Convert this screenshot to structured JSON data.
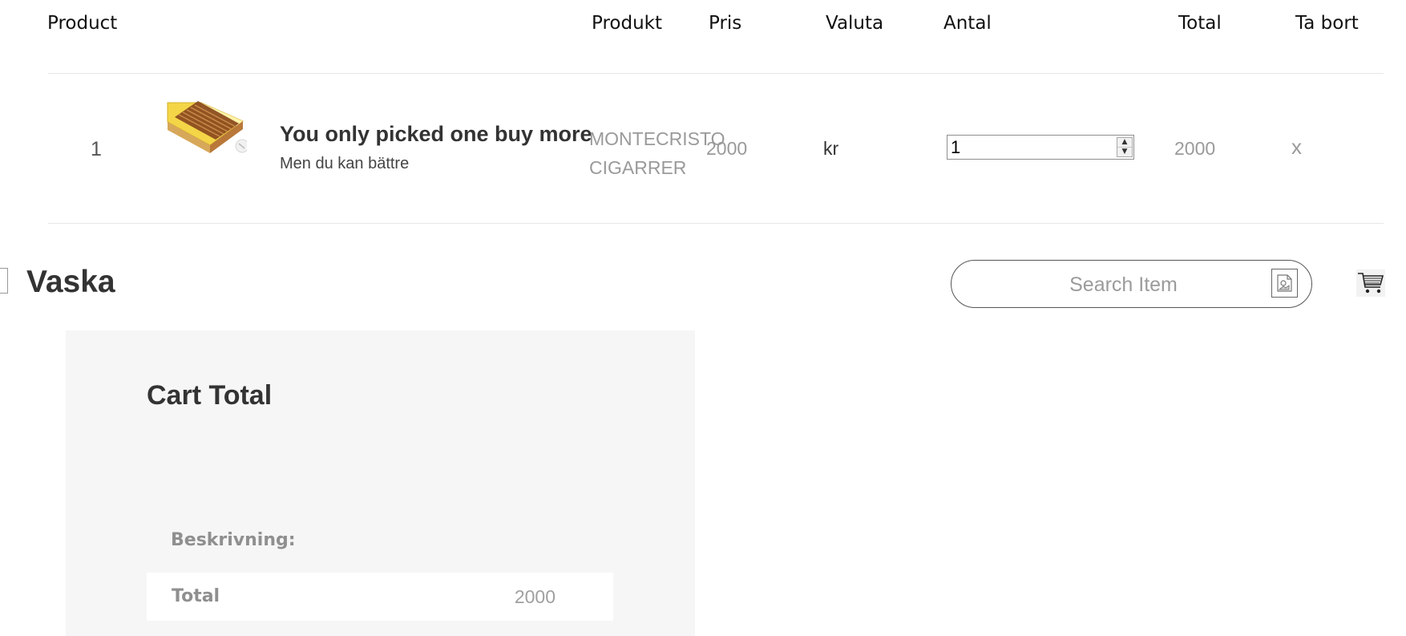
{
  "cart_table": {
    "headers": {
      "product": "Product",
      "produkt": "Produkt",
      "pris": "Pris",
      "valuta": "Valuta",
      "antal": "Antal",
      "total": "Total",
      "ta_bort": "Ta bort"
    },
    "rows": [
      {
        "index": "1",
        "title": "You only picked one buy more",
        "subtitle": "Men du kan bättre",
        "produkt_line1": "MONTECRISTO",
        "produkt_line2": "CIGARRER",
        "pris": "2000",
        "valuta": "kr",
        "antal": "1",
        "total": "2000",
        "remove": "x"
      }
    ]
  },
  "vaska": {
    "title": "Vaska",
    "search_placeholder": "Search Item"
  },
  "cart_total": {
    "title": "Cart Total",
    "description_label": "Beskrivning:",
    "total_label": "Total",
    "total_value": "2000"
  },
  "colors": {
    "text_dark": "#333333",
    "text_muted": "#9a9a9a",
    "panel_bg": "#f6f6f6",
    "divider": "#e6e6e6"
  },
  "icons": {
    "search": "image-search-icon",
    "cart": "shopping-cart-icon",
    "product": "cigar-box-image"
  }
}
